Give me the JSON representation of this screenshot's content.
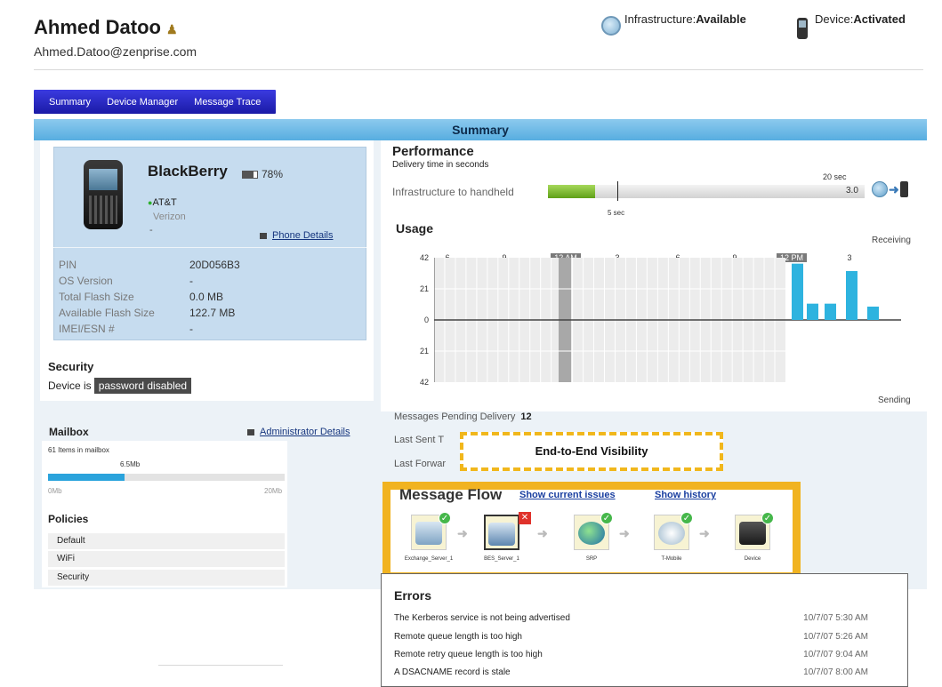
{
  "header": {
    "user_name": "Ahmed Datoo",
    "user_email": "Ahmed.Datoo@zenprise.com",
    "infra_label": "Infrastructure:",
    "infra_value": "Available",
    "device_label": "Device:",
    "device_value": "Activated"
  },
  "tabs": [
    {
      "label": "Summary"
    },
    {
      "label": "Device Manager"
    },
    {
      "label": "Message Trace"
    }
  ],
  "summary_title": "Summary",
  "device": {
    "name": "BlackBerry",
    "battery": "78%",
    "battery_level": 0.78,
    "carrier": "AT&T",
    "network": "Verizon",
    "dash": "-",
    "phone_details": "Phone Details",
    "specs": [
      {
        "label": "PIN",
        "value": "20D056B3"
      },
      {
        "label": "OS Version",
        "value": "-"
      },
      {
        "label": "Total Flash Size",
        "value": "0.0 MB"
      },
      {
        "label": "Available Flash Size",
        "value": "122.7 MB"
      },
      {
        "label": "IMEI/ESN #",
        "value": "-"
      }
    ]
  },
  "security": {
    "title": "Security",
    "text": "Device is",
    "badge": "password  disabled"
  },
  "mailbox": {
    "title": "Mailbox",
    "admin_link": "Administrator Details",
    "items_text": "61 Items in mailbox",
    "size": "6.5Mb",
    "min": "0Mb",
    "max": "20Mb",
    "usage_fraction": 0.325
  },
  "policies": {
    "title": "Policies",
    "items": [
      "Default",
      "WiFi",
      "Security"
    ]
  },
  "performance": {
    "title": "Performance",
    "subtitle": "Delivery time in seconds",
    "label": "Infrastructure to handheld",
    "max_label": "20 sec",
    "marker_label": "5 sec",
    "value": "3.0",
    "value_num": 3.0,
    "max_num": 20
  },
  "usage": {
    "title": "Usage",
    "receiving": "Receiving",
    "sending": "Sending",
    "y_ticks": [
      "42",
      "21",
      "0",
      "21",
      "42"
    ],
    "x_ticks": [
      {
        "label": "6",
        "hl": false
      },
      {
        "label": "9",
        "hl": false
      },
      {
        "label": "12 AM",
        "hl": true
      },
      {
        "label": "3",
        "hl": false
      },
      {
        "label": "6",
        "hl": false
      },
      {
        "label": "9",
        "hl": false
      },
      {
        "label": "12 PM",
        "hl": true
      },
      {
        "label": "3",
        "hl": false
      }
    ]
  },
  "messages": {
    "pending_label": "Messages Pending Delivery",
    "pending_value": "12",
    "last_sent": "Last Sent T",
    "last_forward": "Last Forwar",
    "callout": "End-to-End Visibility"
  },
  "flow": {
    "title": "Message Flow",
    "link_current": "Show current issues",
    "link_history": "Show history",
    "nodes": [
      {
        "label": "Exchange_Server_1",
        "status": "ok",
        "icon": "server-icon"
      },
      {
        "label": "BES_Server_1",
        "status": "error",
        "icon": "server-icon"
      },
      {
        "label": "SRP",
        "status": "ok",
        "icon": "globe-icon"
      },
      {
        "label": "T-Mobile",
        "status": "ok",
        "icon": "tower-icon"
      },
      {
        "label": "Device",
        "status": "ok",
        "icon": "device-icon"
      }
    ]
  },
  "errors": {
    "title": "Errors",
    "rows": [
      {
        "text": "The Kerberos service is not being advertised",
        "date": "10/7/07 5:30 AM"
      },
      {
        "text": "Remote queue length is too high",
        "date": "10/7/07 5:26 AM"
      },
      {
        "text": "Remote retry queue length is too high",
        "date": "10/7/07 9:04 AM"
      },
      {
        "text": "A DSACNAME record is stale",
        "date": "10/7/07 8:00 AM"
      }
    ]
  },
  "chart_data": {
    "type": "bar",
    "title": "Usage",
    "xlabel": "",
    "ylabel": "",
    "ylim": [
      -42,
      42
    ],
    "x_ticks": [
      "6",
      "9",
      "12 AM",
      "3",
      "6",
      "9",
      "12 PM",
      "3"
    ],
    "series": [
      {
        "name": "Receiving",
        "values": [
          38,
          11,
          11,
          33,
          9
        ]
      }
    ],
    "grid": true,
    "legend": "none"
  }
}
